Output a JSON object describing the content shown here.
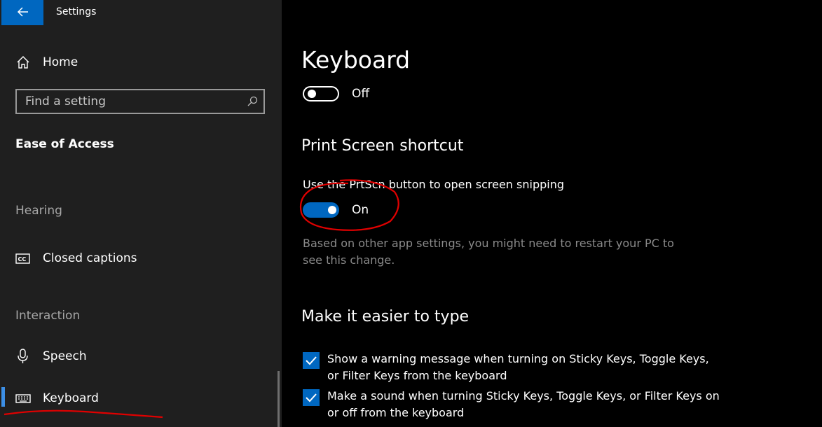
{
  "window": {
    "title": "Settings",
    "back_icon": "back-arrow-icon"
  },
  "sidebar": {
    "home_label": "Home",
    "search_placeholder": "Find a setting",
    "section_title": "Ease of Access",
    "groups": {
      "hearing": "Hearing",
      "interaction": "Interaction"
    },
    "items": {
      "closed_captions": "Closed captions",
      "speech": "Speech",
      "keyboard": "Keyboard"
    },
    "selected": "Keyboard",
    "accent_color": "#0067c0"
  },
  "main": {
    "page_title": "Keyboard",
    "top_toggle": {
      "state_label": "Off",
      "value": false
    },
    "print_screen": {
      "heading": "Print Screen shortcut",
      "description": "Use the PrtScn button to open screen snipping",
      "toggle_label": "On",
      "value": true,
      "note": "Based on other app settings, you might need to restart your PC to see this change."
    },
    "easier_to_type": {
      "heading": "Make it easier to type",
      "options": [
        {
          "label": "Show a warning message when turning on Sticky Keys, Toggle Keys, or Filter Keys from the keyboard",
          "checked": true
        },
        {
          "label": "Make a sound when turning Sticky Keys, Toggle Keys, or Filter Keys on or off from the keyboard",
          "checked": true
        }
      ]
    }
  },
  "annotations": {
    "color": "#e00000"
  }
}
